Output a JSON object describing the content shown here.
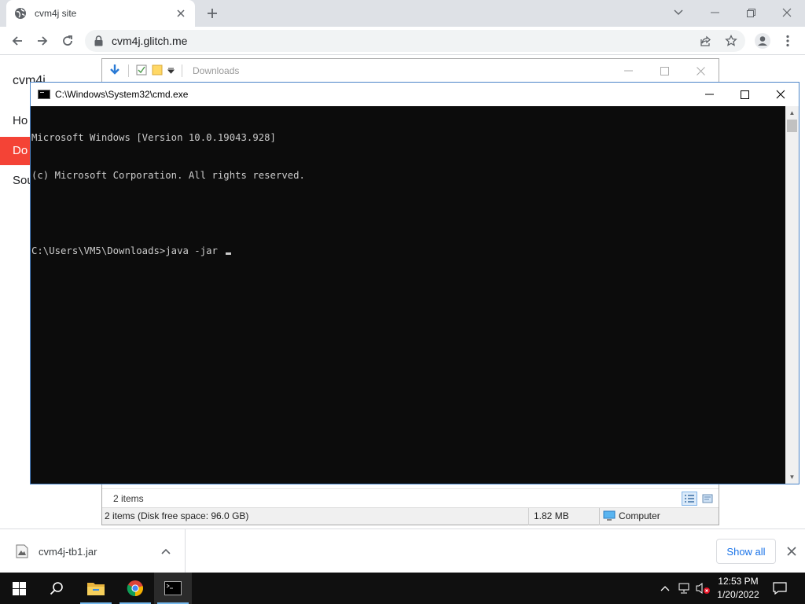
{
  "browser": {
    "tab_title": "cvm4j site",
    "url": "cvm4j.glitch.me"
  },
  "site": {
    "brand": "cvm4j",
    "nav": [
      "Ho",
      "Do",
      "Sou"
    ]
  },
  "explorer": {
    "title": "Downloads",
    "items_count": "2 items",
    "status_summary": "2 items (Disk free space: 96.0 GB)",
    "status_size": "1.82 MB",
    "status_location": "Computer"
  },
  "cmd": {
    "title": "C:\\Windows\\System32\\cmd.exe",
    "lines": [
      "Microsoft Windows [Version 10.0.19043.928]",
      "(c) Microsoft Corporation. All rights reserved.",
      "",
      "C:\\Users\\VM5\\Downloads>java -jar "
    ]
  },
  "downloads": {
    "file_name": "cvm4j-tb1.jar",
    "show_all": "Show all"
  },
  "taskbar": {
    "time": "12:53 PM",
    "date": "1/20/2022"
  },
  "colors": {
    "accent_red": "#f44336",
    "console_bg": "#0c0c0c",
    "console_fg": "#cccccc",
    "chrome_blue": "#1a73e8"
  }
}
